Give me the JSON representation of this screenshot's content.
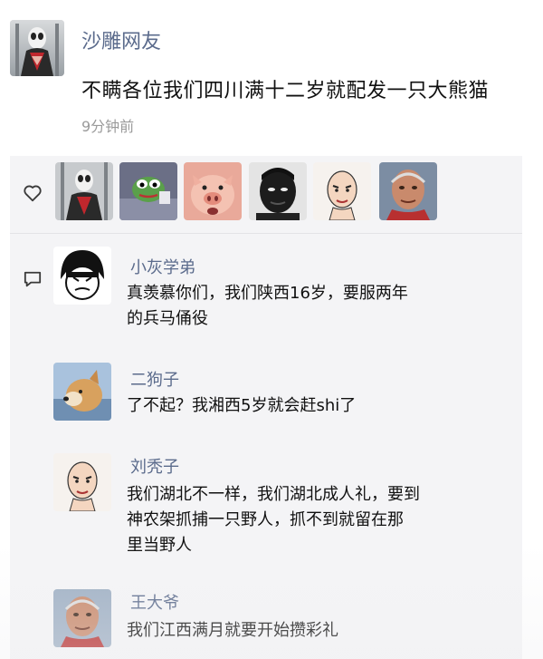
{
  "post": {
    "author": "沙雕网友",
    "content": "不瞒各位我们四川满十二岁就配发一只大熊猫",
    "time": "9分钟前"
  },
  "likes": {
    "icon": "heart-icon",
    "avatars": [
      "spiderman-meme",
      "pepe-frog",
      "pig-face",
      "dark-face",
      "bald-cartoon",
      "old-man-photo"
    ]
  },
  "comments": [
    {
      "name": "小灰学弟",
      "lines": [
        "真羡慕你们，我们陕西16岁，要服两年",
        "的兵马俑役"
      ]
    },
    {
      "name": "二狗子",
      "lines": [
        "了不起？我湘西5岁就会赶shi了"
      ]
    },
    {
      "name": "刘秃子",
      "lines": [
        "我们湖北不一样，我们湖北成人礼，要到",
        "神农架抓捕一只野人，抓不到就留在那",
        "里当野人"
      ]
    },
    {
      "name": "王大爷",
      "lines": [
        "我们江西满月就要开始攒彩礼"
      ]
    }
  ],
  "colors": {
    "name_blue": "#5b6b8c",
    "panel_bg": "#f4f4f6",
    "time_gray": "#9a9a9a"
  }
}
